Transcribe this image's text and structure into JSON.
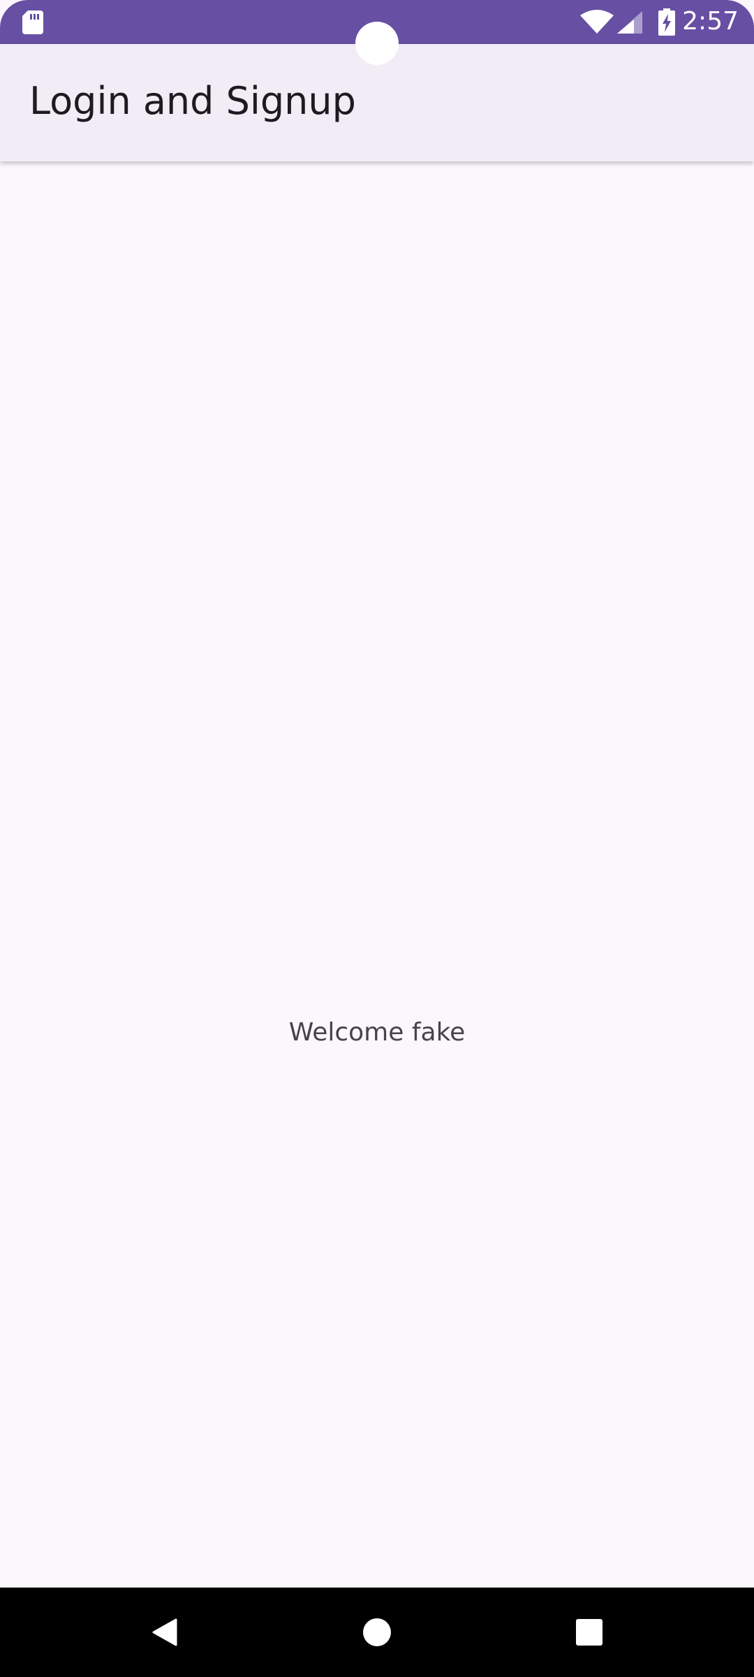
{
  "status_bar": {
    "time": "2:57",
    "color": "#6750A4",
    "icons": [
      "sd-card-icon",
      "wifi-icon",
      "cell-signal-icon",
      "battery-charging-icon"
    ]
  },
  "app_bar": {
    "title": "Login and Signup",
    "background": "#F2ECF6"
  },
  "content": {
    "welcome_message": "Welcome fake",
    "background": "#FCF6FD"
  },
  "navigation_bar": {
    "buttons": [
      "back-icon",
      "home-icon",
      "recents-icon"
    ]
  }
}
